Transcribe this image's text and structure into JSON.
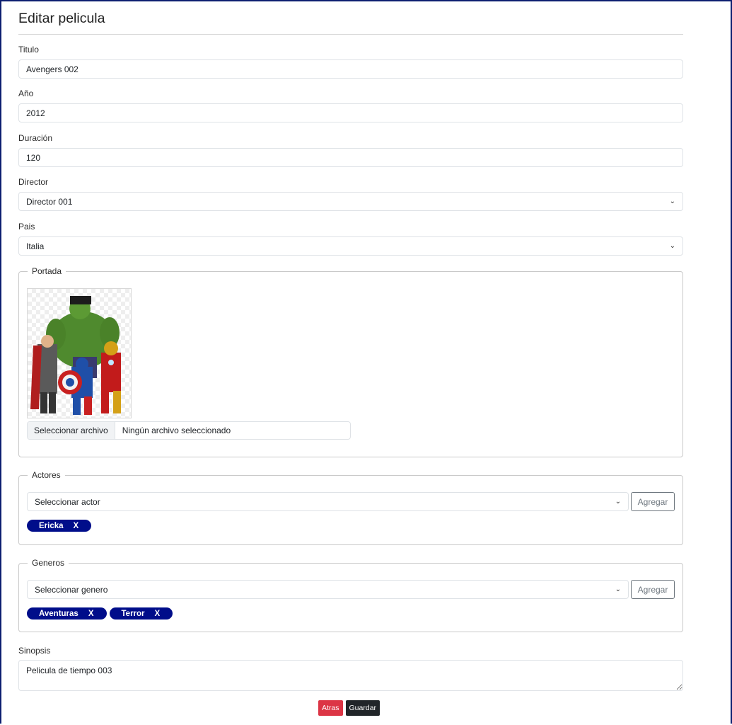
{
  "page": {
    "title": "Editar pelicula"
  },
  "form": {
    "titulo": {
      "label": "Titulo",
      "value": "Avengers 002"
    },
    "anio": {
      "label": "Año",
      "value": "2012"
    },
    "duracion": {
      "label": "Duración",
      "value": "120"
    },
    "director": {
      "label": "Director",
      "value": "Director 001"
    },
    "pais": {
      "label": "Pais",
      "value": "Italia"
    },
    "sinopsis": {
      "label": "Sinopsis",
      "value": "Pelicula de tiempo 003"
    }
  },
  "portada": {
    "legend": "Portada",
    "file_button": "Seleccionar archivo",
    "file_status": "Ningún archivo seleccionado"
  },
  "actores": {
    "legend": "Actores",
    "select_value": "Seleccionar actor",
    "add_label": "Agregar",
    "chips": [
      {
        "label": "Ericka",
        "remove": "X"
      }
    ]
  },
  "generos": {
    "legend": "Generos",
    "select_value": "Seleccionar genero",
    "add_label": "Agregar",
    "chips": [
      {
        "label": "Aventuras",
        "remove": "X"
      },
      {
        "label": "Terror",
        "remove": "X"
      }
    ]
  },
  "actions": {
    "back_label": "Atras",
    "save_label": "Guardar"
  },
  "colors": {
    "frame": "#0d1f70",
    "chip": "#000d8a",
    "back": "#dc3545",
    "save": "#212529"
  }
}
